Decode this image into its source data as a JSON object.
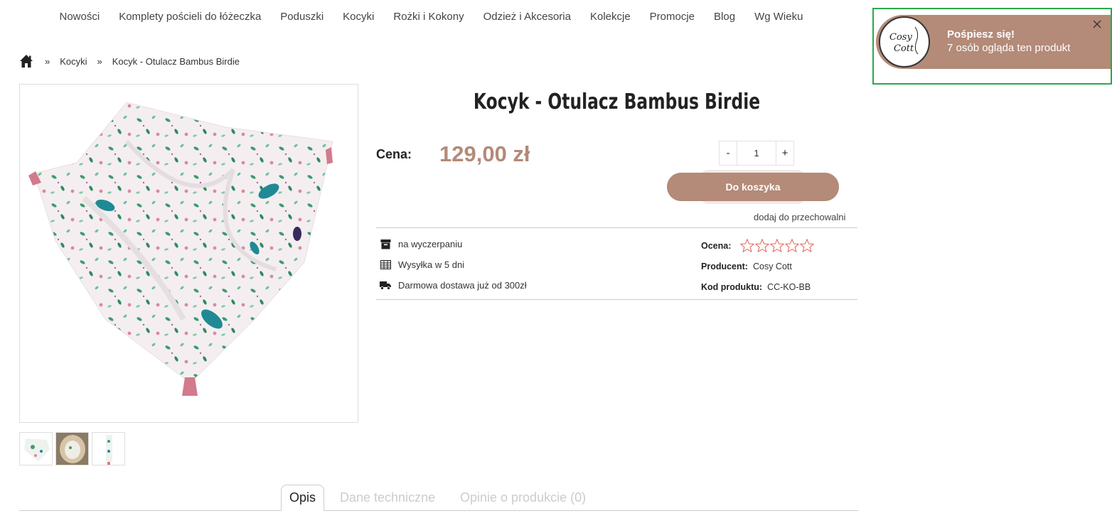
{
  "nav": {
    "items": [
      "Nowości",
      "Komplety pościeli do łóżeczka",
      "Poduszki",
      "Kocyki",
      "Rożki i Kokony",
      "Odzież i Akcesoria",
      "Kolekcje",
      "Promocje",
      "Blog",
      "Wg Wieku"
    ]
  },
  "breadcrumb": {
    "home_icon": "home-icon",
    "separator": "»",
    "category": "Kocyki",
    "current": "Kocyk - Otulacz Bambus Birdie"
  },
  "product": {
    "title": "Kocyk - Otulacz Bambus Birdie",
    "price_label": "Cena:",
    "price": "129,00 zł",
    "qty_minus": "-",
    "qty_value": "1",
    "qty_plus": "+",
    "cart_label": "Do koszyka",
    "storage_link": "dodaj do przechowalni",
    "availability": "na wyczerpaniu",
    "shipping": "Wysyłka w 5 dni",
    "free_delivery": "Darmowa dostawa już od 300zł",
    "rating_label": "Ocena:",
    "rating_stars": 5,
    "rating_value": 0,
    "producer_label": "Producent:",
    "producer": "Cosy Cott",
    "code_label": "Kod produktu:",
    "code": "CC-KO-BB"
  },
  "tabs": [
    "Opis",
    "Dane techniczne",
    "Opinie o produkcie (0)"
  ],
  "notification": {
    "title": "Pośpiesz się!",
    "message": "7 osób ogląda ten produkt",
    "logo_text": "Cosy Cott"
  },
  "colors": {
    "accent": "#b48a78",
    "highlight_outline": "#2ea84a",
    "star": "#e26a5c"
  }
}
